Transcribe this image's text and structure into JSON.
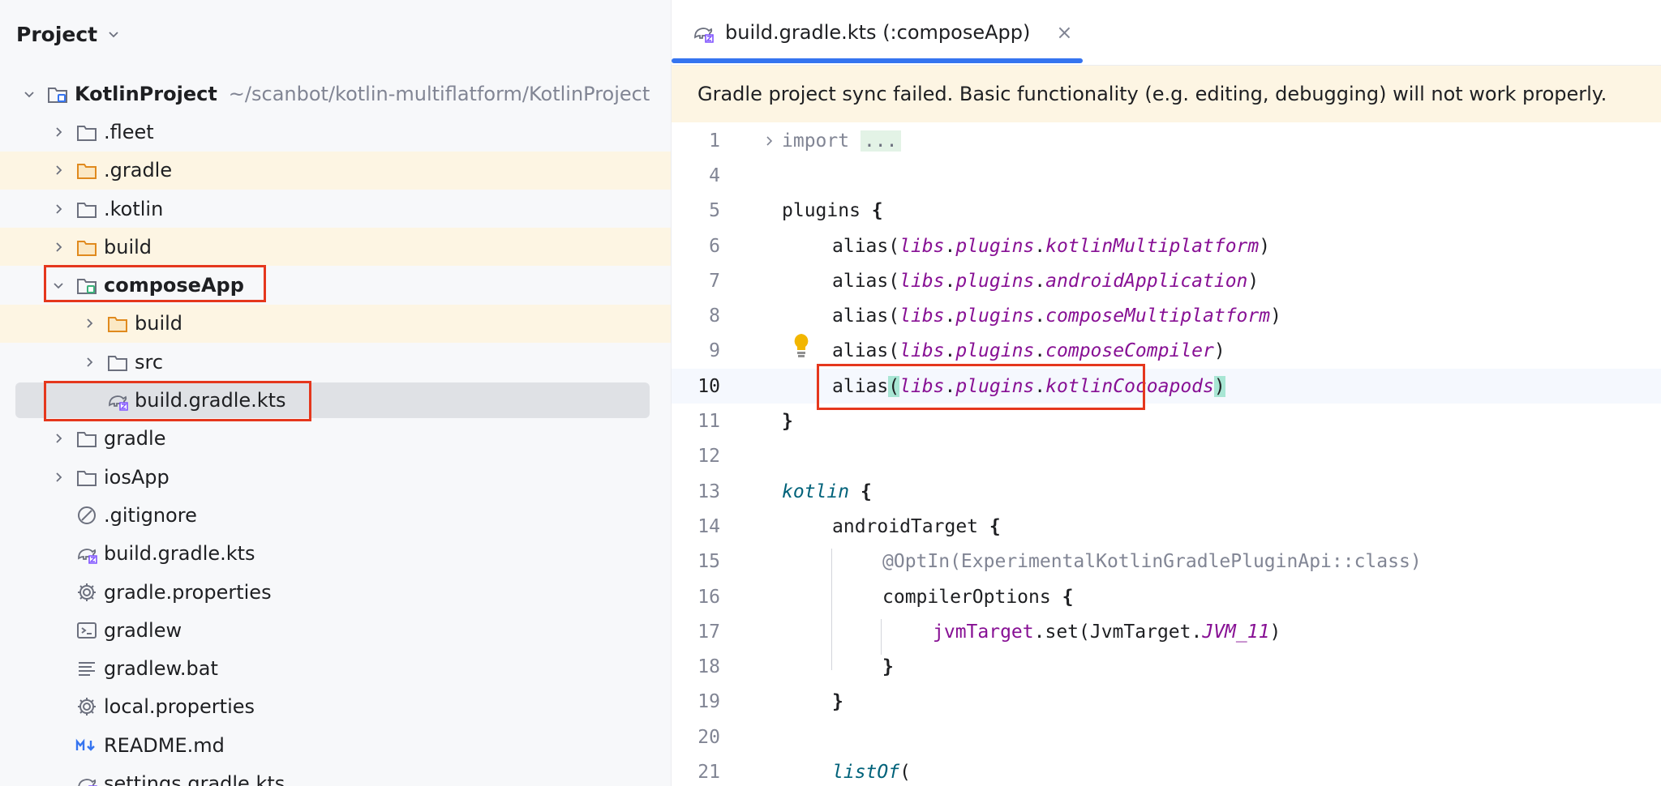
{
  "panel": {
    "title": "Project"
  },
  "tree": [
    {
      "label": "KotlinProject",
      "path": "~/scanbot/kotlin-multiflatform/KotlinProject"
    },
    {
      "label": ".fleet"
    },
    {
      "label": ".gradle"
    },
    {
      "label": ".kotlin"
    },
    {
      "label": "build"
    },
    {
      "label": "composeApp"
    },
    {
      "label": "build"
    },
    {
      "label": "src"
    },
    {
      "label": "build.gradle.kts"
    },
    {
      "label": "gradle"
    },
    {
      "label": "iosApp"
    },
    {
      "label": ".gitignore"
    },
    {
      "label": "build.gradle.kts"
    },
    {
      "label": "gradle.properties"
    },
    {
      "label": "gradlew"
    },
    {
      "label": "gradlew.bat"
    },
    {
      "label": "local.properties"
    },
    {
      "label": "README.md"
    },
    {
      "label": "settings.gradle.kts"
    }
  ],
  "editor": {
    "tab_label": "build.gradle.kts (:composeApp)",
    "tab_close": "×",
    "banner": "Gradle project sync failed. Basic functionality (e.g. editing, debugging) will not work properly."
  },
  "code": {
    "line_numbers": [
      "1",
      "4",
      "5",
      "6",
      "7",
      "8",
      "9",
      "10",
      "11",
      "12",
      "13",
      "14",
      "15",
      "16",
      "17",
      "18",
      "19",
      "20",
      "21"
    ],
    "t": {
      "import": "import",
      "dots": "...",
      "plugins": "plugins",
      "brace_open": "{",
      "brace_close": "}",
      "alias": "alias",
      "libs": "libs",
      "plugins_acc": "plugins",
      "dot": ".",
      "lp": "(",
      "rp": ")",
      "kotlinMultiplatform": "kotlinMultiplatform",
      "androidApplication": "androidApplication",
      "composeMultiplatform": "composeMultiplatform",
      "composeCompiler": "composeCompiler",
      "kotlinCocoapods": "kotlinCocoapods",
      "kotlin": "kotlin",
      "androidTarget": "androidTarget",
      "optin": "@OptIn(ExperimentalKotlinGradlePluginApi::class)",
      "compilerOptions": "compilerOptions",
      "jvmTarget": "jvmTarget",
      "set_open": ".set(JvmTarget.",
      "jvm11": "JVM_11",
      "listOf": "listOf"
    }
  },
  "colors": {
    "accent": "#3574f0",
    "highlight_box": "#e5371d",
    "banner_bg": "#fdf5e3",
    "ignored_row_bg": "#fdf5e3",
    "selected_row_bg": "#dfe1e5"
  }
}
